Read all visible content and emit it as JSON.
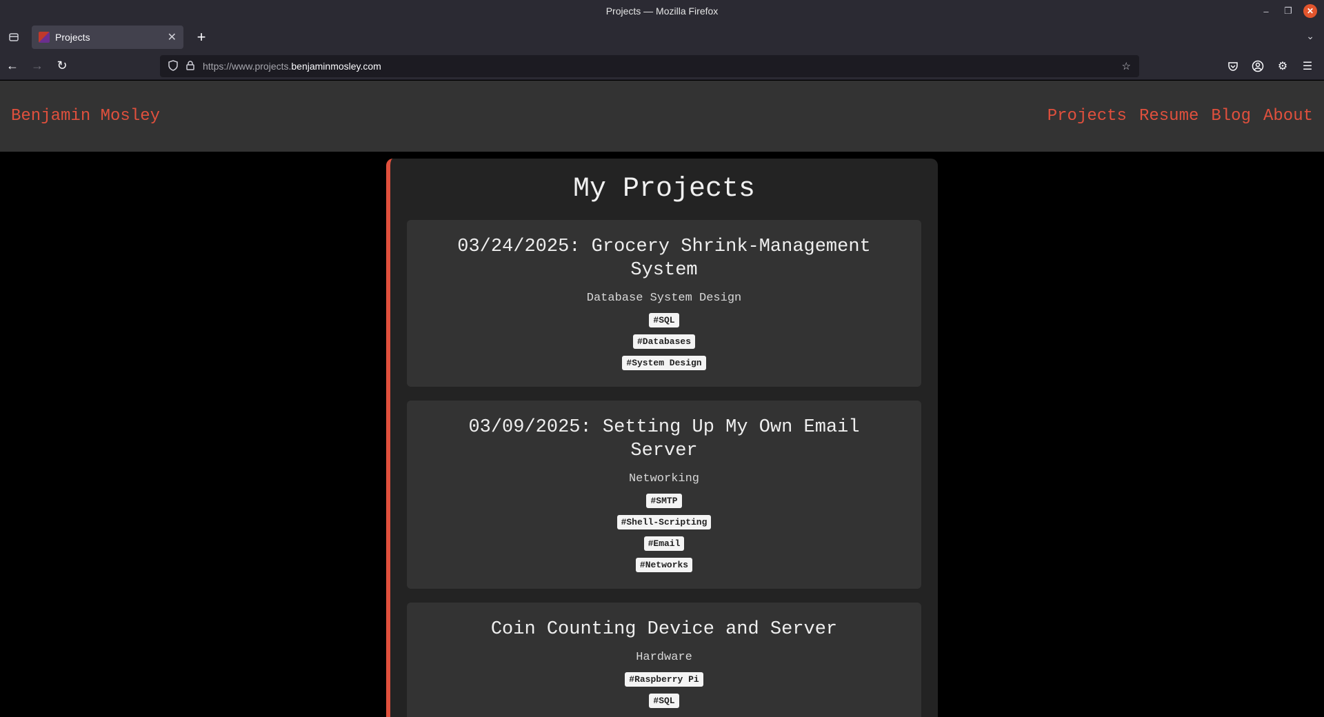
{
  "browser": {
    "window_title": "Projects — Mozilla Firefox",
    "tab_title": "Projects",
    "url_prefix": "https://www.projects.",
    "url_domain": "benjaminmosley.com"
  },
  "site": {
    "brand": "Benjamin Mosley",
    "nav": [
      "Projects",
      "Resume",
      "Blog",
      "About"
    ]
  },
  "page": {
    "heading": "My Projects",
    "projects": [
      {
        "title": "03/24/2025: Grocery Shrink-Management System",
        "category": "Database System Design",
        "tags": [
          "#SQL",
          "#Databases",
          "#System Design"
        ]
      },
      {
        "title": "03/09/2025: Setting Up My Own Email Server",
        "category": "Networking",
        "tags": [
          "#SMTP",
          "#Shell-Scripting",
          "#Email",
          "#Networks"
        ]
      },
      {
        "title": "Coin Counting Device and Server",
        "category": "Hardware",
        "tags": [
          "#Raspberry Pi",
          "#SQL"
        ]
      }
    ]
  },
  "colors": {
    "accent": "#e0503d",
    "card_bg": "#333333",
    "content_bg": "#232323"
  }
}
